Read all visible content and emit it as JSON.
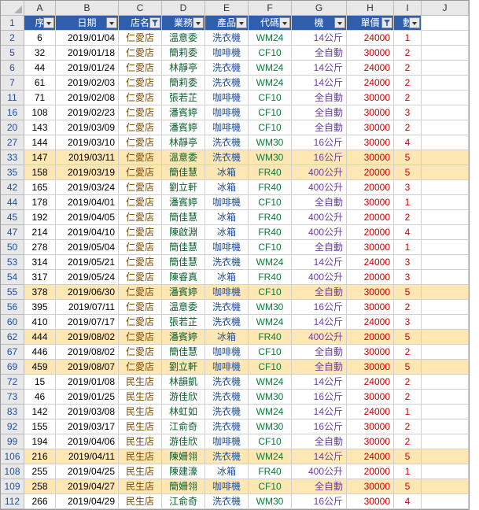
{
  "colLetters": [
    "A",
    "B",
    "C",
    "D",
    "E",
    "F",
    "G",
    "H",
    "I",
    "J"
  ],
  "headers": [
    "序",
    "日期",
    "店名",
    "業務",
    "產品",
    "代碼",
    "機",
    "單價",
    "數"
  ],
  "filters": [
    false,
    false,
    true,
    false,
    false,
    false,
    false,
    true,
    false
  ],
  "rows": [
    {
      "n": 2,
      "hl": false,
      "c": [
        "6",
        "2019/01/04",
        "仁愛店",
        "溫意委",
        "洗衣機",
        "WM24",
        "14公斤",
        "24000",
        "1"
      ]
    },
    {
      "n": 5,
      "hl": false,
      "c": [
        "32",
        "2019/01/18",
        "仁愛店",
        "簡莉委",
        "咖啡機",
        "CF10",
        "全自動",
        "30000",
        "2"
      ]
    },
    {
      "n": 6,
      "hl": false,
      "c": [
        "44",
        "2019/01/24",
        "仁愛店",
        "林靜亭",
        "洗衣機",
        "WM24",
        "14公斤",
        "24000",
        "2"
      ]
    },
    {
      "n": 7,
      "hl": false,
      "c": [
        "61",
        "2019/02/03",
        "仁愛店",
        "簡莉委",
        "洗衣機",
        "WM24",
        "14公斤",
        "24000",
        "2"
      ]
    },
    {
      "n": 11,
      "hl": false,
      "c": [
        "71",
        "2019/02/08",
        "仁愛店",
        "張若芷",
        "咖啡機",
        "CF10",
        "全自動",
        "30000",
        "2"
      ]
    },
    {
      "n": 16,
      "hl": false,
      "c": [
        "108",
        "2019/02/23",
        "仁愛店",
        "潘賓婷",
        "咖啡機",
        "CF10",
        "全自動",
        "30000",
        "3"
      ]
    },
    {
      "n": 20,
      "hl": false,
      "c": [
        "143",
        "2019/03/09",
        "仁愛店",
        "潘賓婷",
        "咖啡機",
        "CF10",
        "全自動",
        "30000",
        "2"
      ]
    },
    {
      "n": 27,
      "hl": false,
      "c": [
        "144",
        "2019/03/10",
        "仁愛店",
        "林靜亭",
        "洗衣機",
        "WM30",
        "16公斤",
        "30000",
        "4"
      ]
    },
    {
      "n": 33,
      "hl": true,
      "c": [
        "147",
        "2019/03/11",
        "仁愛店",
        "溫意委",
        "洗衣機",
        "WM30",
        "16公斤",
        "30000",
        "5"
      ]
    },
    {
      "n": 35,
      "hl": true,
      "c": [
        "158",
        "2019/03/19",
        "仁愛店",
        "簡佳慧",
        "冰箱",
        "FR40",
        "400公升",
        "20000",
        "5"
      ]
    },
    {
      "n": 42,
      "hl": false,
      "c": [
        "165",
        "2019/03/24",
        "仁愛店",
        "劉立軒",
        "冰箱",
        "FR40",
        "400公升",
        "20000",
        "3"
      ]
    },
    {
      "n": 44,
      "hl": false,
      "c": [
        "178",
        "2019/04/01",
        "仁愛店",
        "潘賓婷",
        "咖啡機",
        "CF10",
        "全自動",
        "30000",
        "1"
      ]
    },
    {
      "n": 45,
      "hl": false,
      "c": [
        "192",
        "2019/04/05",
        "仁愛店",
        "簡佳慧",
        "冰箱",
        "FR40",
        "400公升",
        "20000",
        "2"
      ]
    },
    {
      "n": 47,
      "hl": false,
      "c": [
        "214",
        "2019/04/10",
        "仁愛店",
        "陳啟淵",
        "冰箱",
        "FR40",
        "400公升",
        "20000",
        "4"
      ]
    },
    {
      "n": 50,
      "hl": false,
      "c": [
        "278",
        "2019/05/04",
        "仁愛店",
        "簡佳慧",
        "咖啡機",
        "CF10",
        "全自動",
        "30000",
        "1"
      ]
    },
    {
      "n": 53,
      "hl": false,
      "c": [
        "314",
        "2019/05/21",
        "仁愛店",
        "簡佳慧",
        "洗衣機",
        "WM24",
        "14公斤",
        "24000",
        "3"
      ]
    },
    {
      "n": 54,
      "hl": false,
      "c": [
        "317",
        "2019/05/24",
        "仁愛店",
        "陳睿真",
        "冰箱",
        "FR40",
        "400公升",
        "20000",
        "3"
      ]
    },
    {
      "n": 55,
      "hl": true,
      "c": [
        "378",
        "2019/06/30",
        "仁愛店",
        "潘賓婷",
        "咖啡機",
        "CF10",
        "全自動",
        "30000",
        "5"
      ]
    },
    {
      "n": 56,
      "hl": false,
      "c": [
        "395",
        "2019/07/11",
        "仁愛店",
        "溫意委",
        "洗衣機",
        "WM30",
        "16公斤",
        "30000",
        "2"
      ]
    },
    {
      "n": 60,
      "hl": false,
      "c": [
        "410",
        "2019/07/17",
        "仁愛店",
        "張若芷",
        "洗衣機",
        "WM24",
        "14公斤",
        "24000",
        "3"
      ]
    },
    {
      "n": 62,
      "hl": true,
      "c": [
        "444",
        "2019/08/02",
        "仁愛店",
        "潘賓婷",
        "冰箱",
        "FR40",
        "400公升",
        "20000",
        "5"
      ]
    },
    {
      "n": 67,
      "hl": false,
      "c": [
        "446",
        "2019/08/02",
        "仁愛店",
        "簡佳慧",
        "咖啡機",
        "CF10",
        "全自動",
        "30000",
        "2"
      ]
    },
    {
      "n": 69,
      "hl": true,
      "c": [
        "459",
        "2019/08/07",
        "仁愛店",
        "劉立軒",
        "咖啡機",
        "CF10",
        "全自動",
        "30000",
        "5"
      ]
    },
    {
      "n": 72,
      "hl": false,
      "c": [
        "15",
        "2019/01/08",
        "民生店",
        "林韻凱",
        "洗衣機",
        "WM24",
        "14公斤",
        "24000",
        "2"
      ]
    },
    {
      "n": 73,
      "hl": false,
      "c": [
        "46",
        "2019/01/25",
        "民生店",
        "游佳欣",
        "洗衣機",
        "WM30",
        "16公斤",
        "30000",
        "2"
      ]
    },
    {
      "n": 83,
      "hl": false,
      "c": [
        "142",
        "2019/03/08",
        "民生店",
        "林虹如",
        "洗衣機",
        "WM24",
        "14公斤",
        "24000",
        "1"
      ]
    },
    {
      "n": 92,
      "hl": false,
      "c": [
        "155",
        "2019/03/17",
        "民生店",
        "江俞奇",
        "洗衣機",
        "WM30",
        "16公斤",
        "30000",
        "2"
      ]
    },
    {
      "n": 99,
      "hl": false,
      "c": [
        "194",
        "2019/04/06",
        "民生店",
        "游佳欣",
        "咖啡機",
        "CF10",
        "全自動",
        "30000",
        "2"
      ]
    },
    {
      "n": 106,
      "hl": true,
      "c": [
        "216",
        "2019/04/11",
        "民生店",
        "陳姍翎",
        "洗衣機",
        "WM24",
        "14公斤",
        "24000",
        "5"
      ]
    },
    {
      "n": 108,
      "hl": false,
      "c": [
        "255",
        "2019/04/25",
        "民生店",
        "陳建濠",
        "冰箱",
        "FR40",
        "400公升",
        "20000",
        "1"
      ]
    },
    {
      "n": 109,
      "hl": true,
      "c": [
        "258",
        "2019/04/27",
        "民生店",
        "簡姍翎",
        "咖啡機",
        "CF10",
        "全自動",
        "30000",
        "5"
      ]
    },
    {
      "n": 112,
      "hl": false,
      "c": [
        "266",
        "2019/04/29",
        "民生店",
        "江俞奇",
        "洗衣機",
        "WM30",
        "16公斤",
        "30000",
        "4"
      ]
    }
  ]
}
